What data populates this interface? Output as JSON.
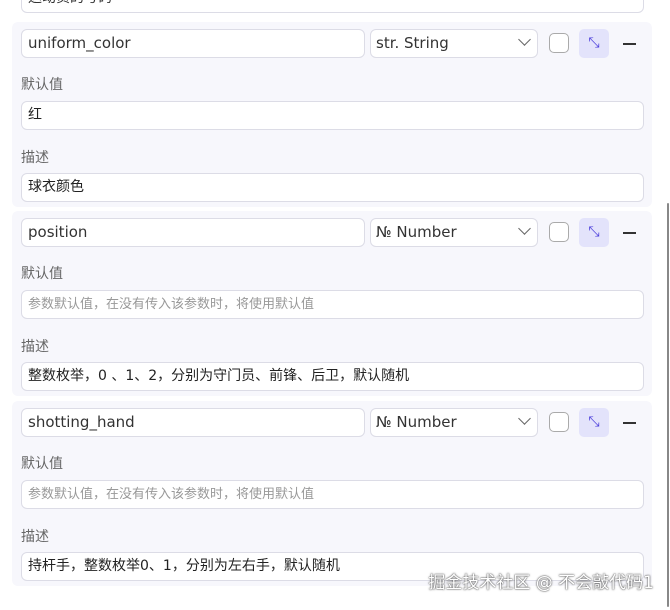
{
  "top_field_value": "运动员的号码",
  "labels": {
    "default": "默认值",
    "desc": "描述"
  },
  "placeholder_default": "参数默认值，在没有传入该参数时，将使用默认值",
  "params": [
    {
      "name": "uniform_color",
      "type": "str. String",
      "default": "红",
      "desc": "球衣颜色"
    },
    {
      "name": "position",
      "type": "№ Number",
      "default": "",
      "desc": "整数枚举，0 、1、2，分别为守门员、前锋、后卫，默认随机"
    },
    {
      "name": "shotting_hand",
      "type": "№ Number",
      "default": "",
      "desc": "持杆手，整数枚举0、1，分别为左右手，默认随机"
    }
  ],
  "watermark": "掘金技术社区 @ 不会敲代码1",
  "accent": "#4a3cdb"
}
